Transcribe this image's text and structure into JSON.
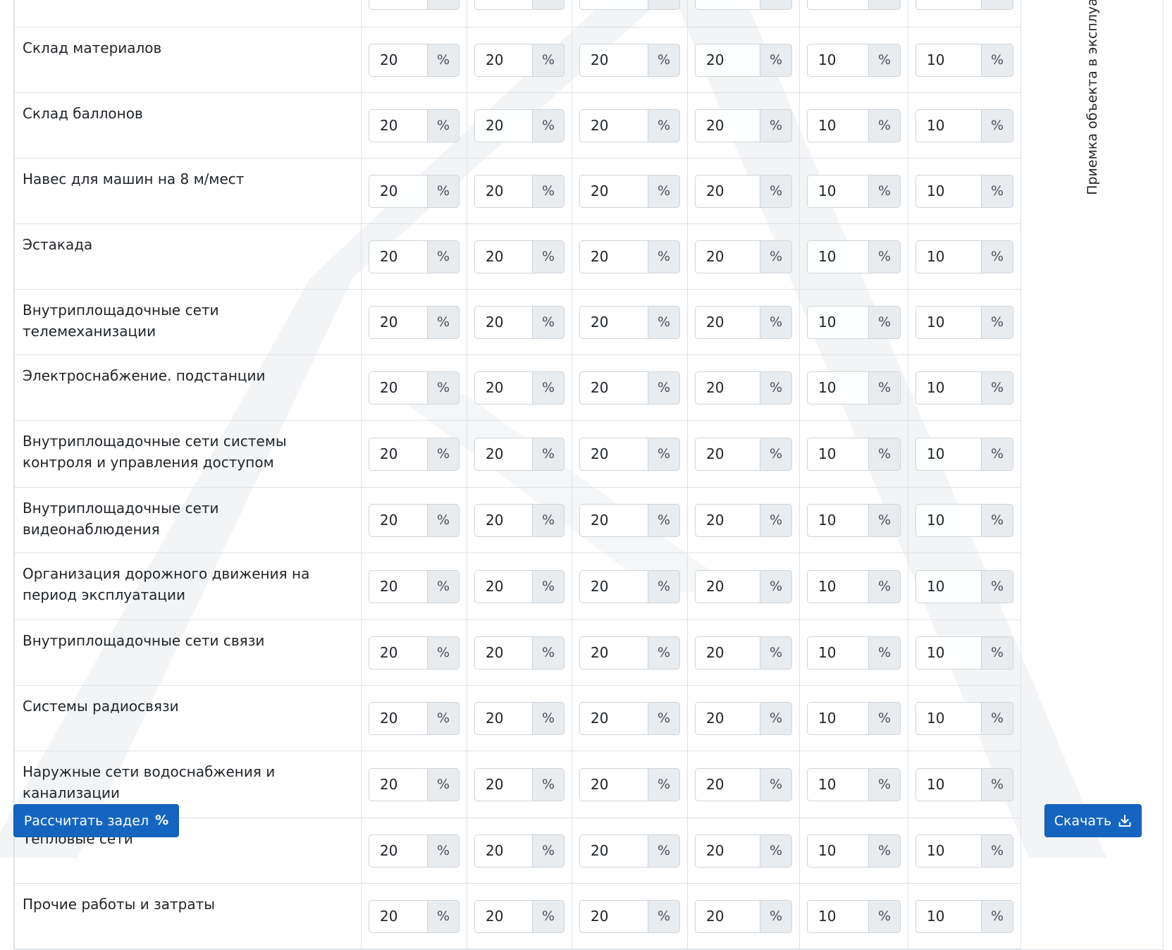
{
  "stage_header": "Приемка объекта в эксплуатацию",
  "unit": "%",
  "rows": [
    {
      "name": "",
      "values": [
        "",
        "",
        "",
        "",
        "",
        ""
      ]
    },
    {
      "name": "Склад материалов",
      "values": [
        "20",
        "20",
        "20",
        "20",
        "10",
        "10"
      ]
    },
    {
      "name": "Склад баллонов",
      "values": [
        "20",
        "20",
        "20",
        "20",
        "10",
        "10"
      ]
    },
    {
      "name": "Навес для машин на 8 м/мест",
      "values": [
        "20",
        "20",
        "20",
        "20",
        "10",
        "10"
      ]
    },
    {
      "name": "Эстакада",
      "values": [
        "20",
        "20",
        "20",
        "20",
        "10",
        "10"
      ]
    },
    {
      "name": "Внутриплощадочные сети телемеханизации",
      "values": [
        "20",
        "20",
        "20",
        "20",
        "10",
        "10"
      ]
    },
    {
      "name": "Электроснабжение. подстанции",
      "values": [
        "20",
        "20",
        "20",
        "20",
        "10",
        "10"
      ]
    },
    {
      "name": "Внутриплощадочные сети системы контроля и управления доступом",
      "values": [
        "20",
        "20",
        "20",
        "20",
        "10",
        "10"
      ]
    },
    {
      "name": "Внутриплощадочные сети видеонаблюдения",
      "values": [
        "20",
        "20",
        "20",
        "20",
        "10",
        "10"
      ]
    },
    {
      "name": "Организация дорожного движения на период эксплуатации",
      "values": [
        "20",
        "20",
        "20",
        "20",
        "10",
        "10"
      ]
    },
    {
      "name": "Внутриплощадочные сети связи",
      "values": [
        "20",
        "20",
        "20",
        "20",
        "10",
        "10"
      ]
    },
    {
      "name": "Системы радиосвязи",
      "values": [
        "20",
        "20",
        "20",
        "20",
        "10",
        "10"
      ]
    },
    {
      "name": "Наружные сети водоснабжения и канализации",
      "values": [
        "20",
        "20",
        "20",
        "20",
        "10",
        "10"
      ]
    },
    {
      "name": "Тепловые сети",
      "values": [
        "20",
        "20",
        "20",
        "20",
        "10",
        "10"
      ]
    },
    {
      "name": "Прочие работы и затраты",
      "values": [
        "20",
        "20",
        "20",
        "20",
        "10",
        "10"
      ]
    }
  ],
  "buttons": {
    "calculate": "Рассчитать задел",
    "download": "Скачать"
  },
  "colors": {
    "primary": "#1565c0",
    "addon_bg": "#e9ecef",
    "border": "#dee2e6",
    "watermark": "#f1f3f5"
  },
  "icons": {
    "calculate": "percent-icon",
    "download": "download-icon"
  }
}
